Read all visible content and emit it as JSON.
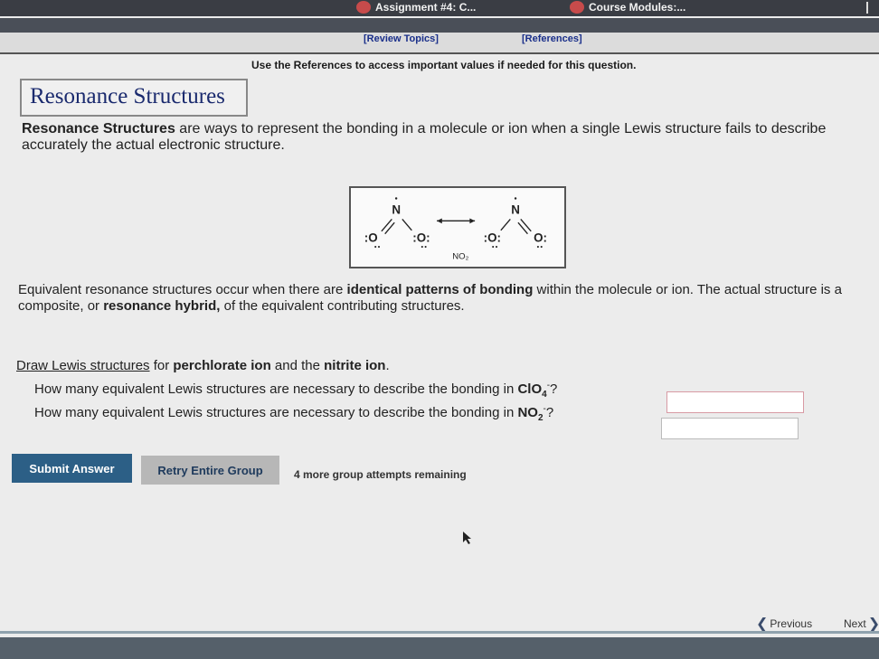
{
  "browser_tabs": [
    {
      "label": "Assignment #4: C...",
      "icon": "tab-favicon-icon"
    },
    {
      "label": "Course Modules:...",
      "icon": "tab-favicon-icon"
    }
  ],
  "header": {
    "review_topics": "[Review Topics]",
    "references": "[References]",
    "use_references": "Use the References to access important values if needed for this question."
  },
  "title": "Resonance Structures",
  "intro": {
    "bold": "Resonance Structures",
    "text": " are ways to represent the bonding in a molecule or ion when a single Lewis structure fails to describe accurately the actual electronic structure."
  },
  "diagram": {
    "caption": "NO₂",
    "left_atoms": [
      ":O",
      "N",
      ":O:"
    ],
    "right_atoms": [
      ":O:",
      "N",
      "O:"
    ]
  },
  "equivalent": {
    "p1": "Equivalent resonance structures occur when there are ",
    "b1": "identical patterns of bonding",
    "p2": " within the molecule or ion. The actual structure is a composite, or ",
    "b2": "resonance hybrid,",
    "p3": " of the equivalent contributing structures."
  },
  "draw": {
    "link": "Draw Lewis structures",
    "t1": " for ",
    "b1": "perchlorate ion",
    "t2": " and the ",
    "b2": "nitrite ion",
    "t3": "."
  },
  "questions": [
    {
      "text": "How many equivalent Lewis structures are necessary to describe the bonding in ",
      "formula": "ClO",
      "sub": "4",
      "sup": "-",
      "end": "?",
      "value": ""
    },
    {
      "text": "How many equivalent Lewis structures are necessary to describe the bonding in ",
      "formula": "NO",
      "sub": "2",
      "sup": "-",
      "end": "?",
      "value": ""
    }
  ],
  "buttons": {
    "submit": "Submit Answer",
    "retry": "Retry Entire Group",
    "attempts": "4 more group attempts remaining"
  },
  "nav": {
    "previous": "Previous",
    "next": "Next"
  }
}
